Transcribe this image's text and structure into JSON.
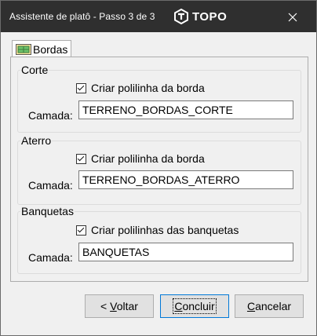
{
  "window": {
    "title": "Assistente de platô  -  Passo 3 de 3",
    "logo_text": "TOPO"
  },
  "tabs": [
    {
      "label": "Bordas",
      "icon": "border-grid-icon"
    }
  ],
  "groups": [
    {
      "title": "Corte",
      "checkbox_label": "Criar polilinha da borda",
      "checked": true,
      "layer_label": "Camada:",
      "layer_value": "TERRENO_BORDAS_CORTE"
    },
    {
      "title": "Aterro",
      "checkbox_label": "Criar polilinha da borda",
      "checked": true,
      "layer_label": "Camada:",
      "layer_value": "TERRENO_BORDAS_ATERRO"
    },
    {
      "title": "Banquetas",
      "checkbox_label": "Criar polilinhas das banquetas",
      "checked": true,
      "layer_label": "Camada:",
      "layer_value": "BANQUETAS"
    }
  ],
  "buttons": {
    "back": {
      "prefix": "< ",
      "mnemonic": "V",
      "rest": "oltar"
    },
    "finish": {
      "prefix": "",
      "mnemonic": "C",
      "rest": "oncluir"
    },
    "cancel": {
      "prefix": "",
      "mnemonic": "C",
      "rest": "ancelar"
    }
  },
  "colors": {
    "titlebar": "#2f2f2f",
    "accent": "#0078d7"
  }
}
